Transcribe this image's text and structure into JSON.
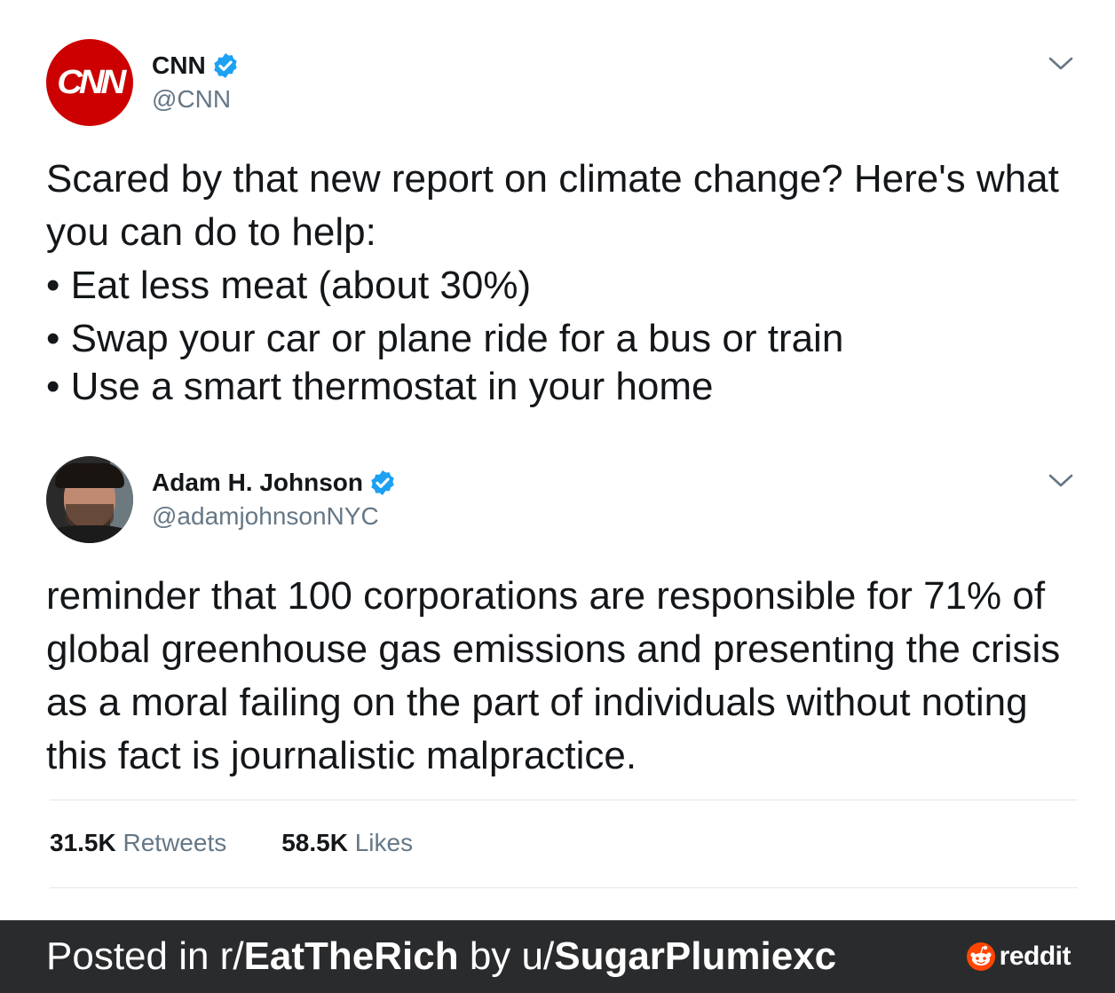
{
  "tweets": [
    {
      "display_name": "CNN",
      "handle": "@CNN",
      "verified": true,
      "avatar_logo_text": "CNN",
      "text_lines": [
        "Scared by that new report on climate change? Here's what",
        "you can do to help:",
        "• Eat less meat (about 30%)",
        "• Swap your car or plane ride for a bus or train",
        "• Use a smart thermostat in your home"
      ]
    },
    {
      "display_name": "Adam H. Johnson",
      "handle": "@adamjohnsonNYC",
      "verified": true,
      "text_lines": [
        "reminder that 100 corporations are responsible for 71% of",
        "global greenhouse gas emissions and presenting the crisis",
        "as a moral failing on the part of individuals without noting",
        "this fact is journalistic malpractice."
      ]
    }
  ],
  "stats": {
    "retweets_count": "31.5K",
    "retweets_label": "Retweets",
    "likes_count": "58.5K",
    "likes_label": "Likes"
  },
  "footer": {
    "prefix": "Posted in r/",
    "subreddit": "EatTheRich",
    "middle": " by u/",
    "username": "SugarPlumiexc",
    "brand": "reddit"
  },
  "colors": {
    "verified_blue": "#1da1f2",
    "cnn_red": "#cc0000",
    "secondary_text": "#657786",
    "footer_bg": "#2a2b2d",
    "reddit_orange": "#ff4500"
  },
  "icons": {
    "verified": "verified-badge-icon",
    "menu": "chevron-down-icon",
    "brand": "reddit-snoo-icon"
  }
}
